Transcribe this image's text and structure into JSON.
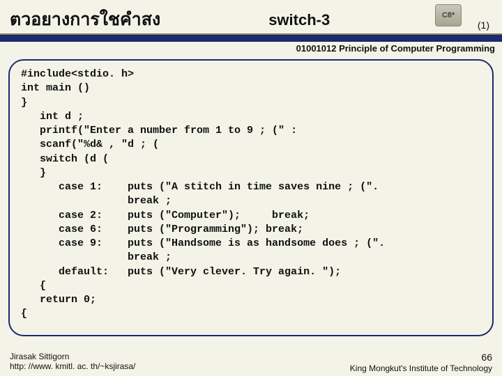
{
  "header": {
    "thai_title": "ตวอยางการใชคำสง",
    "main_title": "switch-3",
    "icon_label": "C8*",
    "page_marker": "(1)"
  },
  "course_line": "01001012 Principle of Computer Programming",
  "code_lines": [
    "#include<stdio. h>",
    "int main ()",
    "}",
    "   int d ;",
    "   printf(\"Enter a number from 1 to 9 ; (\" :",
    "   scanf(\"%d& , \"d ; (",
    "   switch (d (",
    "   }",
    "      case 1:    puts (\"A stitch in time saves nine ; (\".",
    "                 break ;",
    "      case 2:    puts (\"Computer\");     break;",
    "      case 6:    puts (\"Programming\"); break;",
    "      case 9:    puts (\"Handsome is as handsome does ; (\".",
    "                 break ;",
    "      default:   puts (\"Very clever. Try again. \");",
    "   {",
    "   return 0;",
    "{"
  ],
  "footer": {
    "author": "Jirasak Sittigorn",
    "url": "http: //www. kmitl. ac. th/~ksjirasa/",
    "page_number": "66",
    "institute": "King Mongkut's Institute of Technology"
  }
}
